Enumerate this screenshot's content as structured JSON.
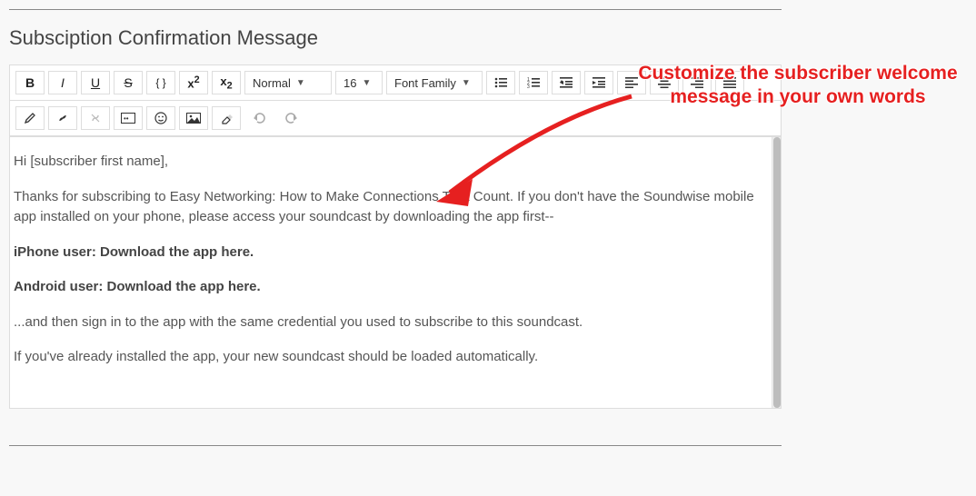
{
  "section_title": "Subsciption Confirmation Message",
  "toolbar": {
    "paragraph_select": "Normal",
    "font_size_select": "16",
    "font_family_select": "Font Family",
    "icons": {
      "bold": "B",
      "italic": "I",
      "underline": "U",
      "strike": "S",
      "braces": "{ }",
      "superscript": "x²",
      "subscript": "x₂",
      "ul": "≣",
      "ol": "≣",
      "outdent": "⇤",
      "indent": "⇥",
      "align_left": "≡",
      "align_center": "≡",
      "align_right": "≡",
      "align_justify": "≡",
      "pencil": "✎",
      "link": "🔗",
      "unlink": "🔗",
      "table": "▦",
      "emoji": "☺",
      "image": "🖼",
      "eraser": "⌫",
      "undo": "↶",
      "redo": "↷"
    }
  },
  "editor": {
    "greeting": "Hi [subscriber first name],",
    "p1": "Thanks for subscribing to Easy Networking: How to Make Connections That Count. If you don't have the Soundwise mobile app installed on your phone, please access your soundcast by downloading the app first--",
    "iphone_label": "iPhone user: Download the app ",
    "iphone_link": "here",
    "dot1": ".",
    "android_label": "Android user: Download the app ",
    "android_link": "here",
    "dot2": ".",
    "p2": "...and then sign in to the app with the same credential you used to subscribe to this soundcast.",
    "p3": "If you've already installed the app, your new soundcast should be loaded automatically."
  },
  "annotation": {
    "text": "Customize the subscriber welcome message in your own words"
  }
}
